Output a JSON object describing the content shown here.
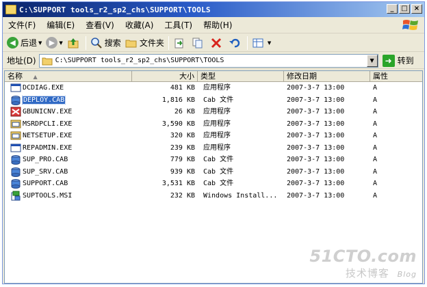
{
  "window": {
    "title": "C:\\SUPPORT tools_r2_sp2_chs\\SUPPORT\\TOOLS",
    "buttons": {
      "minimize": "_",
      "maximize": "□",
      "close": "×"
    }
  },
  "menu": [
    {
      "label": "文件(F)"
    },
    {
      "label": "编辑(E)"
    },
    {
      "label": "查看(V)"
    },
    {
      "label": "收藏(A)"
    },
    {
      "label": "工具(T)"
    },
    {
      "label": "帮助(H)"
    }
  ],
  "toolbar": {
    "back_label": "后退",
    "search_label": "搜索",
    "folders_label": "文件夹"
  },
  "address": {
    "label": "地址(D)",
    "value": "C:\\SUPPORT tools_r2_sp2_chs\\SUPPORT\\TOOLS",
    "go_label": "转到"
  },
  "columns": {
    "name": "名称",
    "size": "大小",
    "type": "类型",
    "modified": "修改日期",
    "attributes": "属性"
  },
  "files": [
    {
      "name": "DCDIAG.EXE",
      "size": "481 KB",
      "type": "应用程序",
      "modified": "2007-3-7  13:00",
      "attr": "A",
      "icon": "exe-icon",
      "selected": false
    },
    {
      "name": "DEPLOY.CAB",
      "size": "1,816 KB",
      "type": "Cab 文件",
      "modified": "2007-3-7  13:00",
      "attr": "A",
      "icon": "cab-icon",
      "selected": true
    },
    {
      "name": "GBUNICNV.EXE",
      "size": "26 KB",
      "type": "应用程序",
      "modified": "2007-3-7  13:00",
      "attr": "A",
      "icon": "app-icon",
      "selected": false
    },
    {
      "name": "MSRDPCLI.EXE",
      "size": "3,590 KB",
      "type": "应用程序",
      "modified": "2007-3-7  13:00",
      "attr": "A",
      "icon": "setup-icon",
      "selected": false
    },
    {
      "name": "NETSETUP.EXE",
      "size": "320 KB",
      "type": "应用程序",
      "modified": "2007-3-7  13:00",
      "attr": "A",
      "icon": "setup-icon",
      "selected": false
    },
    {
      "name": "REPADMIN.EXE",
      "size": "239 KB",
      "type": "应用程序",
      "modified": "2007-3-7  13:00",
      "attr": "A",
      "icon": "exe-icon",
      "selected": false
    },
    {
      "name": "SUP_PRO.CAB",
      "size": "779 KB",
      "type": "Cab 文件",
      "modified": "2007-3-7  13:00",
      "attr": "A",
      "icon": "cab-icon",
      "selected": false
    },
    {
      "name": "SUP_SRV.CAB",
      "size": "939 KB",
      "type": "Cab 文件",
      "modified": "2007-3-7  13:00",
      "attr": "A",
      "icon": "cab-icon",
      "selected": false
    },
    {
      "name": "SUPPORT.CAB",
      "size": "3,531 KB",
      "type": "Cab 文件",
      "modified": "2007-3-7  13:00",
      "attr": "A",
      "icon": "cab-icon",
      "selected": false
    },
    {
      "name": "SUPTOOLS.MSI",
      "size": "232 KB",
      "type": "Windows Install...",
      "modified": "2007-3-7  13:00",
      "attr": "A",
      "icon": "msi-icon",
      "selected": false
    }
  ],
  "watermark": {
    "site": "51CTO.com",
    "tagline": "技术博客",
    "blog": "Blog"
  },
  "colors": {
    "title_start": "#0a246a",
    "title_end": "#a6caf0",
    "selection": "#316ac5",
    "chrome": "#ece9d8"
  }
}
